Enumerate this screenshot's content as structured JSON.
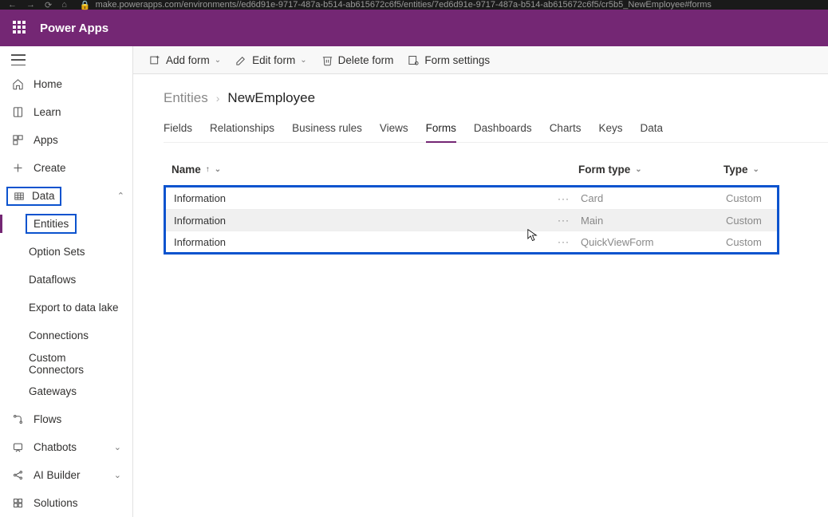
{
  "browser": {
    "url": "make.powerapps.com/environments//ed6d91e-9717-487a-b514-ab615672c6f5/entities/7ed6d91e-9717-487a-b514-ab615672c6f5/cr5b5_NewEmployee#forms"
  },
  "header": {
    "app_title": "Power Apps"
  },
  "sidebar": {
    "items": {
      "home": "Home",
      "learn": "Learn",
      "apps": "Apps",
      "create": "Create",
      "data": "Data",
      "flows": "Flows",
      "chatbots": "Chatbots",
      "ai_builder": "AI Builder",
      "solutions": "Solutions"
    },
    "data_children": {
      "entities": "Entities",
      "option_sets": "Option Sets",
      "dataflows": "Dataflows",
      "export_to_data_lake": "Export to data lake",
      "connections": "Connections",
      "custom_connectors": "Custom Connectors",
      "gateways": "Gateways"
    }
  },
  "cmd": {
    "add_form": "Add form",
    "edit_form": "Edit form",
    "delete_form": "Delete form",
    "form_settings": "Form settings"
  },
  "breadcrumb": {
    "parent": "Entities",
    "current": "NewEmployee"
  },
  "tabs": {
    "fields": "Fields",
    "relationships": "Relationships",
    "business_rules": "Business rules",
    "views": "Views",
    "forms": "Forms",
    "dashboards": "Dashboards",
    "charts": "Charts",
    "keys": "Keys",
    "data": "Data"
  },
  "columns": {
    "name": "Name",
    "form_type": "Form type",
    "type": "Type"
  },
  "rows": [
    {
      "name": "Information",
      "form_type": "Card",
      "type": "Custom"
    },
    {
      "name": "Information",
      "form_type": "Main",
      "type": "Custom"
    },
    {
      "name": "Information",
      "form_type": "QuickViewForm",
      "type": "Custom"
    }
  ]
}
